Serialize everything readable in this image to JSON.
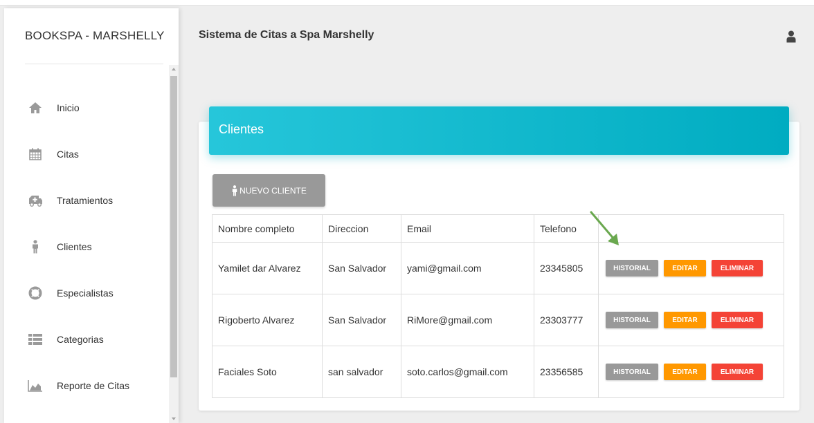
{
  "sidebar": {
    "brand": "BOOKSPA - MARSHELLY",
    "items": [
      {
        "label": "Inicio",
        "icon": "home-icon"
      },
      {
        "label": "Citas",
        "icon": "calendar-icon"
      },
      {
        "label": "Tratamientos",
        "icon": "ambulance-icon"
      },
      {
        "label": "Clientes",
        "icon": "person-icon"
      },
      {
        "label": "Especialistas",
        "icon": "life-ring-icon"
      },
      {
        "label": "Categorias",
        "icon": "list-icon"
      },
      {
        "label": "Reporte de Citas",
        "icon": "area-chart-icon"
      }
    ]
  },
  "header": {
    "title": "Sistema de Citas a Spa Marshelly",
    "user_icon": "user-icon"
  },
  "card": {
    "title": "Clientes",
    "new_button_label": "NUEVO CLIENTE"
  },
  "table": {
    "columns": [
      "Nombre completo",
      "Direccion",
      "Email",
      "Telefono",
      ""
    ],
    "rows": [
      {
        "name": "Yamilet dar Alvarez",
        "address": "San Salvador",
        "email": "yami@gmail.com",
        "phone": "23345805"
      },
      {
        "name": "Rigoberto Alvarez",
        "address": "San Salvador",
        "email": "RiMore@gmail.com",
        "phone": "23303777"
      },
      {
        "name": "Faciales Soto",
        "address": "san salvador",
        "email": "soto.carlos@gmail.com",
        "phone": "23356585"
      }
    ],
    "actions": {
      "history": "HISTORIAL",
      "edit": "EDITAR",
      "delete": "ELIMINAR"
    }
  },
  "colors": {
    "header_start": "#26c6da",
    "header_end": "#00acc1",
    "history_button": "#999999",
    "edit_button": "#ff9800",
    "delete_button": "#f44336",
    "annotation_arrow": "#6aa84f"
  }
}
